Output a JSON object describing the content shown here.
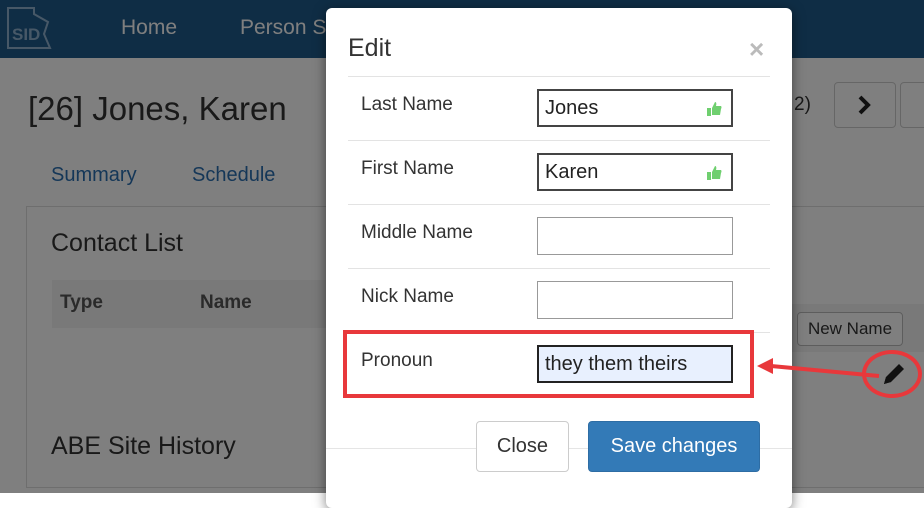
{
  "navbar": {
    "logo_text": "SID",
    "items": [
      "Home",
      "Person S"
    ]
  },
  "page": {
    "title": "[26] Jones, Karen",
    "pager_text": "2)",
    "tabs": [
      "Summary",
      "Schedule"
    ],
    "contact_list": {
      "title": "Contact List",
      "columns": [
        "Type",
        "Name"
      ]
    },
    "new_name_button": "New Name",
    "abe_title": "ABE Site History"
  },
  "modal": {
    "title": "Edit",
    "close_symbol": "×",
    "fields": [
      {
        "label": "Last Name",
        "value": "Jones"
      },
      {
        "label": "First Name",
        "value": "Karen"
      },
      {
        "label": "Middle Name",
        "value": ""
      },
      {
        "label": "Nick Name",
        "value": ""
      },
      {
        "label": "Pronoun",
        "value": "they them theirs"
      }
    ],
    "close_button": "Close",
    "save_button": "Save changes"
  },
  "colors": {
    "navbar": "#1f5a8a",
    "primary": "#337ab7",
    "highlight": "#e8383b"
  },
  "icons": [
    "sid-logo-icon",
    "chevron-right-icon",
    "pencil-icon",
    "thumbs-up-icon",
    "close-icon"
  ]
}
